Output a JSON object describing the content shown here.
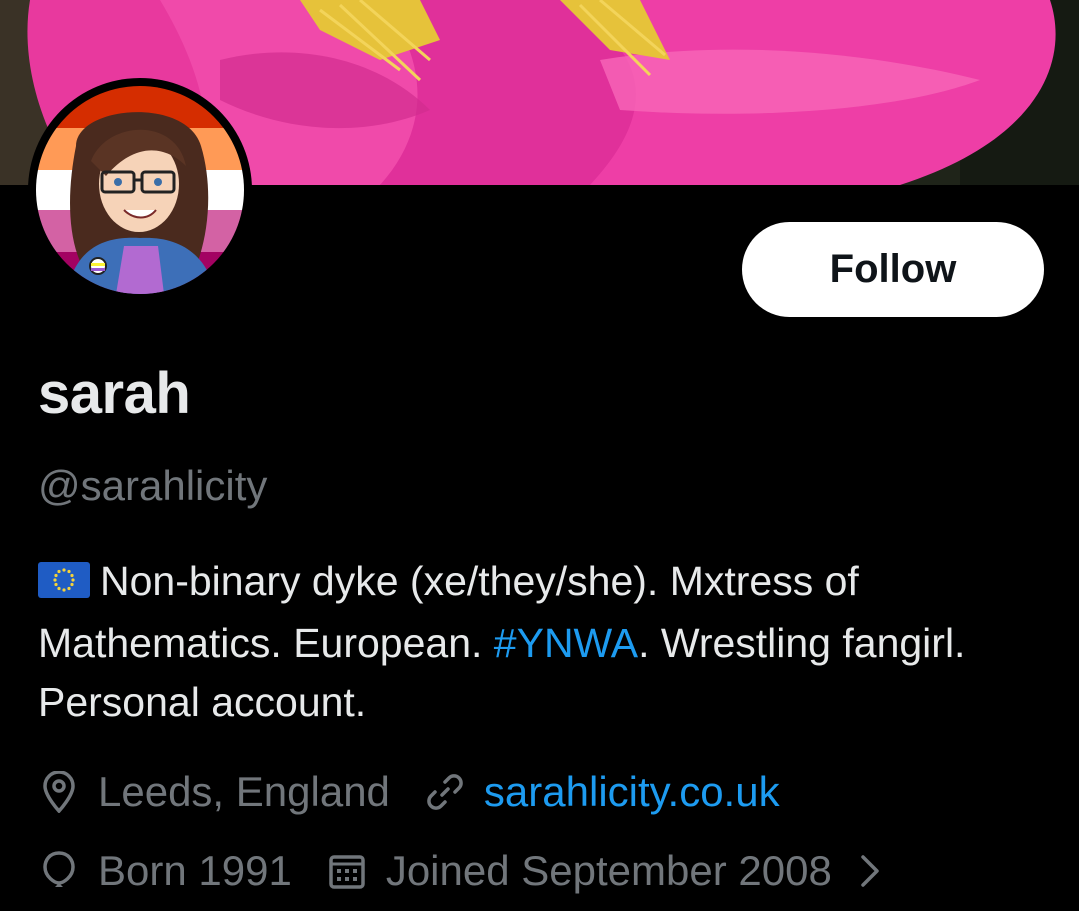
{
  "profile": {
    "display_name": "sarah",
    "handle": "@sarahlicity",
    "bio_flag_icon": "eu-flag-icon",
    "bio_part1": "Non-binary dyke (xe/they/she). Mxtress of Mathematics. European. ",
    "bio_hashtag": "#YNWA",
    "bio_part2": ". Wrestling fangirl. Personal account.",
    "location": "Leeds, England",
    "website": "sarahlicity.co.uk",
    "birth": "Born 1991",
    "joined": "Joined September 2008"
  },
  "actions": {
    "follow_label": "Follow"
  },
  "colors": {
    "background": "#000000",
    "text": "#e7e9ea",
    "muted": "#71767b",
    "link": "#1d9bf0",
    "follow_bg": "#ffffff",
    "banner_flower": "#e4309a"
  },
  "icons": {
    "location": "map-pin-icon",
    "website": "link-icon",
    "birth": "balloon-icon",
    "joined": "calendar-icon",
    "more": "chevron-right-icon"
  }
}
